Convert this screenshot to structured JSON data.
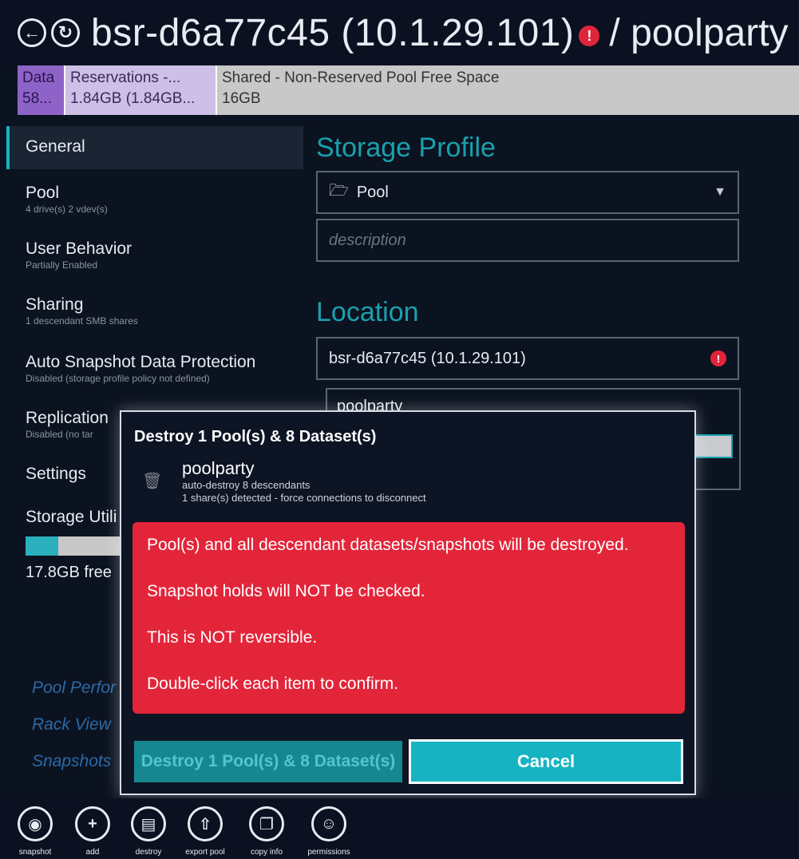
{
  "header": {
    "back_icon": "back-arrow-icon",
    "refresh_icon": "refresh-icon",
    "host": "bsr-d6a77c45 (10.1.29.101)",
    "path": "/ poolparty"
  },
  "usage": {
    "data_label": "Data",
    "data_value": "58...",
    "reservations_label": "Reservations -...",
    "reservations_value": "1.84GB (1.84GB...",
    "shared_label": "Shared - Non-Reserved Pool Free Space",
    "shared_value": "16GB"
  },
  "sidebar": {
    "items": [
      {
        "title": "General",
        "sub": ""
      },
      {
        "title": "Pool",
        "sub": "4 drive(s) 2 vdev(s)"
      },
      {
        "title": "User Behavior",
        "sub": "Partially Enabled"
      },
      {
        "title": "Sharing",
        "sub": "1 descendant SMB shares"
      },
      {
        "title": "Auto Snapshot Data Protection",
        "sub": "Disabled (storage profile policy not defined)"
      },
      {
        "title": "Replication",
        "sub": "Disabled (no tar"
      },
      {
        "title": "Settings",
        "sub": ""
      },
      {
        "title": "Storage Utili",
        "sub": ""
      }
    ],
    "utilization_fraction": 0.12,
    "free_text": "17.8GB free",
    "links": [
      "Pool Perfor",
      "Rack View",
      "Snapshots"
    ]
  },
  "main": {
    "storage_profile_heading": "Storage Profile",
    "profile_value": "Pool",
    "description_placeholder": "description",
    "location_heading": "Location",
    "location_value": "bsr-d6a77c45 (10.1.29.101)",
    "pool_name": "poolparty"
  },
  "dialog": {
    "title": "Destroy 1 Pool(s) & 8 Dataset(s)",
    "item_name": "poolparty",
    "item_sub1": "auto-destroy 8 descendants",
    "item_sub2": "1 share(s) detected - force connections to disconnect",
    "warnings": [
      "Pool(s) and all descendant datasets/snapshots will be destroyed.",
      "Snapshot holds will NOT be checked.",
      "This is NOT reversible.",
      "Double-click each item to confirm."
    ],
    "destroy_label": "Destroy 1 Pool(s) & 8 Dataset(s)",
    "cancel_label": "Cancel"
  },
  "toolbar": {
    "items": [
      {
        "label": "snapshot",
        "icon": "camera-icon"
      },
      {
        "label": "add",
        "icon": "plus-icon"
      },
      {
        "label": "destroy",
        "icon": "trash-icon"
      },
      {
        "label": "export pool",
        "icon": "export-icon"
      },
      {
        "label": "copy info",
        "icon": "copy-icon"
      },
      {
        "label": "permissions",
        "icon": "permissions-icon"
      }
    ]
  },
  "colors": {
    "accent": "#16b4c2",
    "danger": "#e3253a",
    "background": "#0c1320"
  }
}
